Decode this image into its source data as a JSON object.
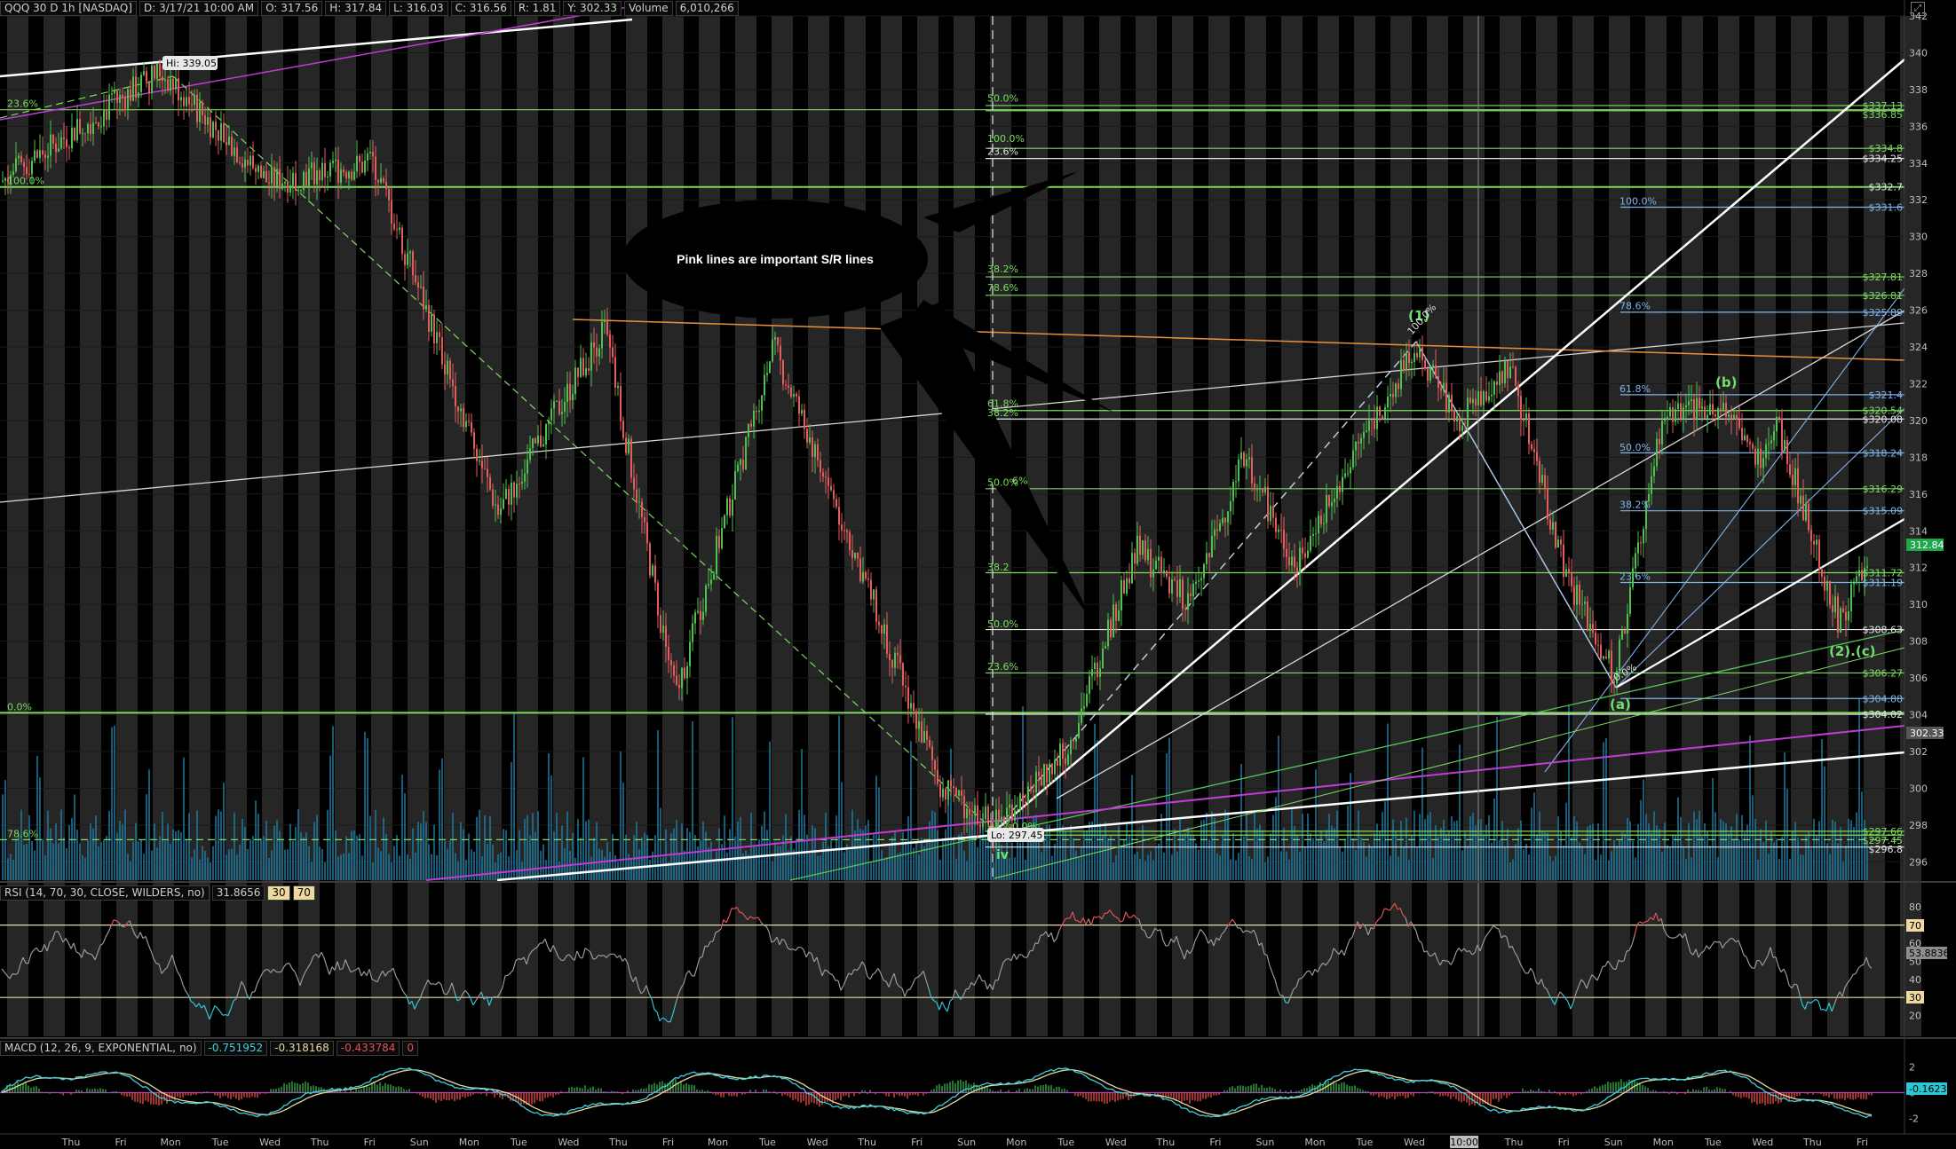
{
  "header": {
    "symbol": "QQQ 30 D 1h [NASDAQ]",
    "date": "D: 3/17/21 10:00 AM",
    "open": "O: 317.56",
    "high": "H: 317.84",
    "low": "L: 316.03",
    "close": "C: 316.56",
    "range": "R: 1.81",
    "y": "Y: 302.33",
    "volume_label": "Volume",
    "volume": "6,010,266"
  },
  "rsi_header": {
    "study": "RSI (14, 70, 30, CLOSE, WILDERS, no)",
    "value": "31.8656",
    "lower": "30",
    "upper": "70"
  },
  "macd_header": {
    "study": "MACD (12, 26, 9, EXPONENTIAL, no)",
    "value": "-0.751952",
    "avg": "-0.318168",
    "diff": "-0.433784",
    "zero": "0"
  },
  "colors": {
    "fib_green": "#7ddc5f",
    "fib_blue": "#7fb4e8",
    "trend_white": "#ffffff",
    "pink": "#c33bd6",
    "orange": "#e8913a",
    "candle_up": "#4fc14f",
    "candle_down": "#e35d5d",
    "volume": "#1e7aa0",
    "rsi_line": "#9a9a9a",
    "rsi_oversold": "#2cc8d6",
    "rsi_overbought": "#e05353",
    "macd_line": "#3fd0e0",
    "macd_signal": "#e8d9a0",
    "last_price_tag": "#1fa84a"
  },
  "annotation": {
    "callout_text": "Pink lines are important S/R lines"
  },
  "labels": {
    "hi": "Hi: 339.05",
    "lo": "Lo: 297.45",
    "wave_1": "(1)",
    "wave_b": "(b)",
    "wave_a": "(a)",
    "wave_2c": "(2).(c)",
    "wave_iv": "iv",
    "pct_100_wave1": "100.0%",
    "pct_0_a": "0.0%"
  },
  "chart_data": {
    "type": "candlestick",
    "price_axis": {
      "min": 295,
      "max": 342,
      "ticks": [
        296,
        298,
        300,
        302,
        304,
        306,
        308,
        310,
        312,
        314,
        316,
        318,
        320,
        322,
        324,
        326,
        328,
        330,
        332,
        334,
        336,
        338,
        340,
        342
      ]
    },
    "last_price": "312.84",
    "y_close_tag": "302.33",
    "x_tick_labels": [
      "Thu",
      "Fri",
      "Mon",
      "Tue",
      "Wed",
      "Thu",
      "Fri",
      "Sun",
      "Mon",
      "Tue",
      "Wed",
      "Thu",
      "Fri",
      "Mon",
      "Tue",
      "Wed",
      "Thu",
      "Fri",
      "Sun",
      "Mon",
      "Tue",
      "Wed",
      "Thu",
      "Fri",
      "Sun",
      "Mon",
      "Tue",
      "Wed",
      "10:00",
      "Thu",
      "Fri",
      "Sun",
      "Mon",
      "Tue",
      "Wed",
      "Thu",
      "Fri"
    ],
    "price_levels_right": [
      {
        "label": "$337.13",
        "price": 337.13,
        "color": "green"
      },
      {
        "label": "$336.85",
        "price": 336.85,
        "color": "green"
      },
      {
        "label": "$334.8",
        "price": 334.8,
        "color": "green"
      },
      {
        "label": "$334.25",
        "price": 334.25,
        "color": "white"
      },
      {
        "label": "$332.7",
        "price": 332.7,
        "color": "white"
      },
      {
        "label": "$331.6",
        "price": 331.6,
        "color": "blue"
      },
      {
        "label": "$327.81",
        "price": 327.81,
        "color": "green"
      },
      {
        "label": "$326.81",
        "price": 326.81,
        "color": "green"
      },
      {
        "label": "$325.89",
        "price": 325.89,
        "color": "blue"
      },
      {
        "label": "$321.4",
        "price": 321.4,
        "color": "blue"
      },
      {
        "label": "$320.54",
        "price": 320.54,
        "color": "green"
      },
      {
        "label": "$320.08",
        "price": 320.08,
        "color": "white"
      },
      {
        "label": "$318.24",
        "price": 318.24,
        "color": "blue"
      },
      {
        "label": "$316.29",
        "price": 316.29,
        "color": "green"
      },
      {
        "label": "$315.09",
        "price": 315.09,
        "color": "blue"
      },
      {
        "label": "$311.72",
        "price": 311.72,
        "color": "green"
      },
      {
        "label": "$311.19",
        "price": 311.19,
        "color": "blue"
      },
      {
        "label": "$308.63",
        "price": 308.63,
        "color": "white"
      },
      {
        "label": "$306.27",
        "price": 306.27,
        "color": "green"
      },
      {
        "label": "$304.88",
        "price": 304.88,
        "color": "blue"
      },
      {
        "label": "$304.02",
        "price": 304.02,
        "color": "white"
      },
      {
        "label": "$297.66",
        "price": 297.66,
        "color": "green"
      },
      {
        "label": "$297.45",
        "price": 297.45,
        "color": "green"
      },
      {
        "label": "$296.8",
        "price": 296.8,
        "color": "white"
      }
    ],
    "fib_labels": [
      {
        "text": "23.6%",
        "price": 336.9,
        "group": "left"
      },
      {
        "text": "100.0%",
        "price": 332.7,
        "group": "left"
      },
      {
        "text": "0.0%",
        "price": 304.1,
        "group": "left"
      },
      {
        "text": "78.6%",
        "price": 297.2,
        "group": "left"
      },
      {
        "text": "50.0%",
        "price": 337.2,
        "group": "mid"
      },
      {
        "text": "100.0%",
        "price": 335.0,
        "group": "mid"
      },
      {
        "text": "23.6%",
        "price": 334.3,
        "group": "mid"
      },
      {
        "text": "38.2%",
        "price": 327.9,
        "group": "mid"
      },
      {
        "text": "78.6%",
        "price": 326.9,
        "group": "mid"
      },
      {
        "text": "61.8%",
        "price": 320.6,
        "group": "mid"
      },
      {
        "text": "38.2%",
        "price": 320.1,
        "group": "mid"
      },
      {
        "text": "50.0%",
        "price": 316.3,
        "group": "mid"
      },
      {
        "text": "6%",
        "price": 316.4,
        "group": "mid"
      },
      {
        "text": "38.2",
        "price": 311.7,
        "group": "mid"
      },
      {
        "text": "50.0%",
        "price": 308.6,
        "group": "mid"
      },
      {
        "text": "23.6%",
        "price": 306.3,
        "group": "mid"
      },
      {
        "text": "0.0%",
        "price": 297.7,
        "group": "mid"
      },
      {
        "text": "0.0%",
        "price": 297.6,
        "group": "mid"
      },
      {
        "text": "100.0%",
        "price": 331.6,
        "group": "right"
      },
      {
        "text": "78.6%",
        "price": 325.9,
        "group": "right"
      },
      {
        "text": "61.8%",
        "price": 321.4,
        "group": "right"
      },
      {
        "text": "50.0%",
        "price": 318.2,
        "group": "right"
      },
      {
        "text": "38.2%",
        "price": 315.1,
        "group": "right"
      },
      {
        "text": "23.6%",
        "price": 311.2,
        "group": "right"
      }
    ],
    "rsi": {
      "axis_ticks": [
        20,
        30,
        40,
        50,
        60,
        70,
        80
      ],
      "overbought": 70,
      "oversold": 30,
      "value_tag": "53.8836",
      "levels_tags": [
        "70",
        "30"
      ]
    },
    "macd": {
      "axis_ticks": [
        2,
        0,
        -2
      ],
      "value_tag": "-0.1623"
    }
  }
}
